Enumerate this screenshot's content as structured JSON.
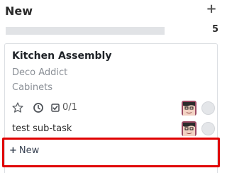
{
  "column": {
    "title": "New",
    "count": "5",
    "progress_fraction": 1.0,
    "add_icon": "plus-icon"
  },
  "card": {
    "title": "Kitchen Assembly",
    "customer": "Deco Addict",
    "project": "Cabinets",
    "subtasks_done": "0/1",
    "icons": [
      "star-icon",
      "clock-icon",
      "checklist-icon"
    ],
    "assignee_avatar": "avatar",
    "status_color": "#e4e6e9"
  },
  "subtask": {
    "name": "test sub-task",
    "assignee_avatar": "avatar",
    "status_color": "#e4e6e9"
  },
  "quick_add": {
    "plus": "+",
    "label": "New"
  },
  "colors": {
    "highlight": "#e00000",
    "progress_track": "#e1e3e6"
  }
}
